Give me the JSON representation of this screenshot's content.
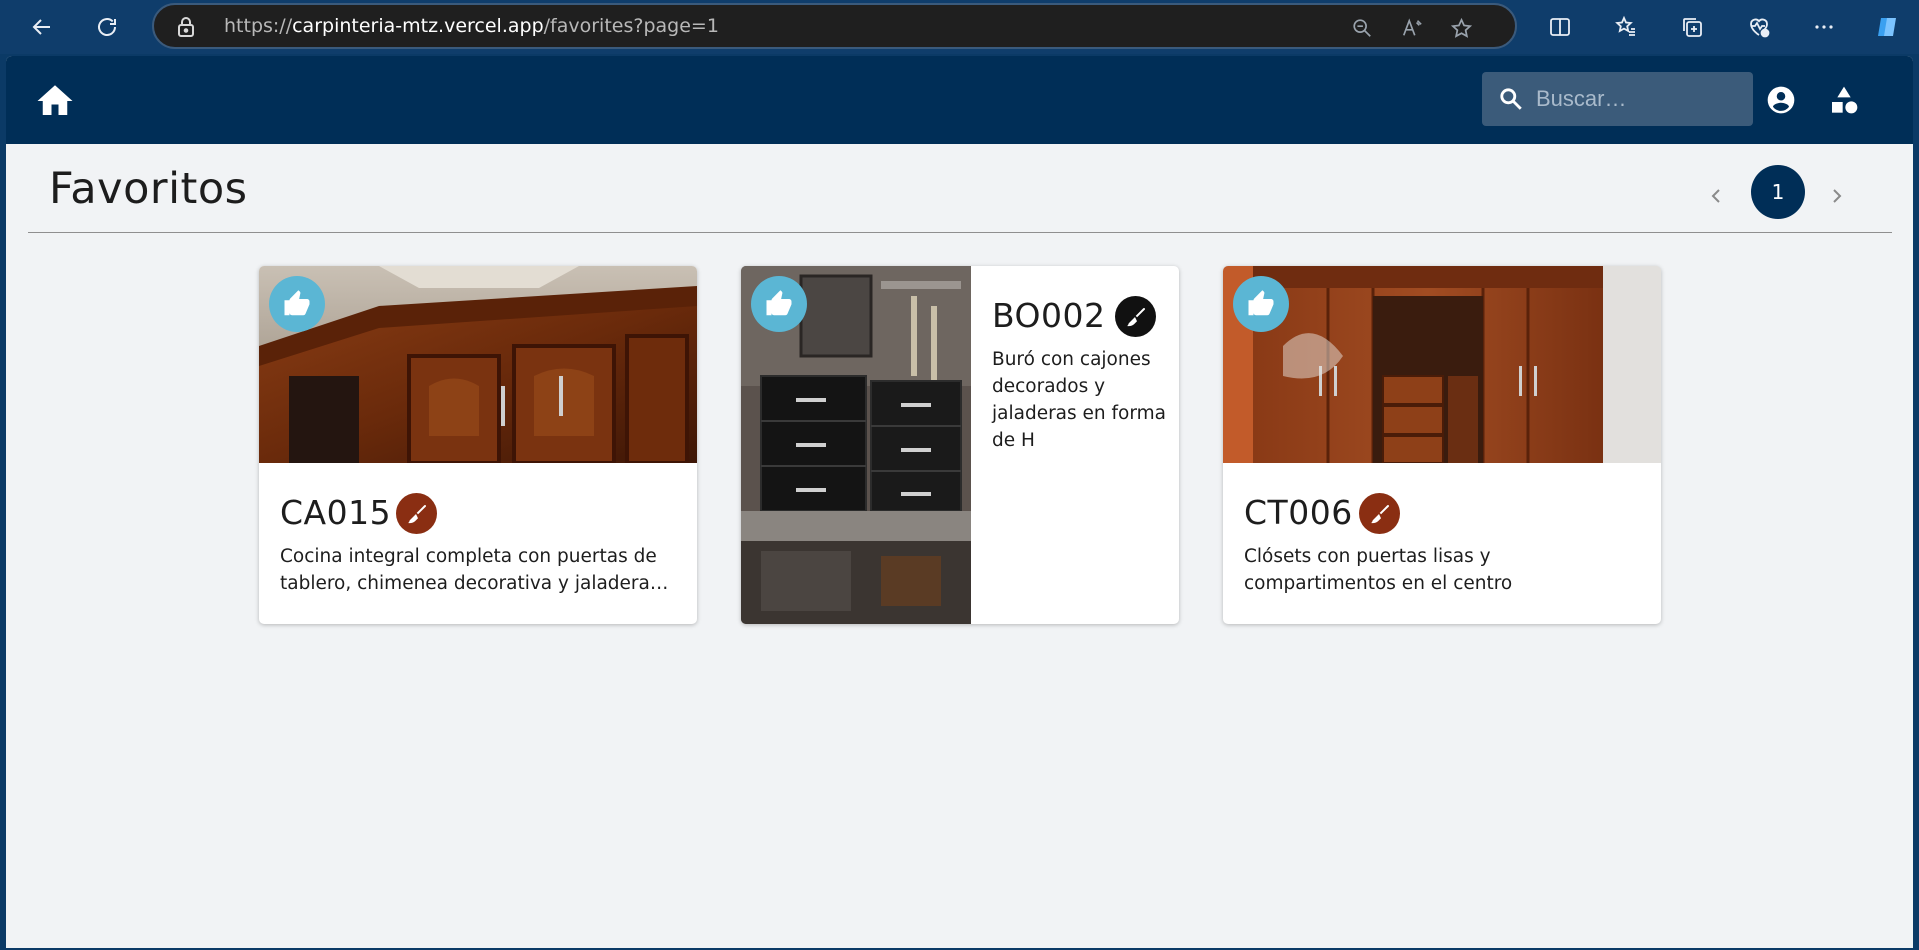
{
  "browser": {
    "url_prefix": "https://",
    "url_host": "carpinteria-mtz.vercel.app",
    "url_path": "/favorites?page=1"
  },
  "header": {
    "search_placeholder": "Buscar…"
  },
  "page": {
    "title": "Favoritos",
    "current_page": "1"
  },
  "cards": [
    {
      "code": "CA015",
      "description": "Cocina integral completa con puertas de tablero, chimenea decorativa y jaladera…",
      "badge_color": "#8a2e12"
    },
    {
      "code": "BO002",
      "description": "Buró con cajones decorados y jaladeras en forma de H",
      "badge_color": "#111111"
    },
    {
      "code": "CT006",
      "description": "Clósets con puertas lisas y compartimentos en el centro",
      "badge_color": "#8a2e12"
    }
  ],
  "colors": {
    "header_bg": "#002e57",
    "like_button": "#5bb6d4",
    "page_bg": "#f1f3f5"
  }
}
